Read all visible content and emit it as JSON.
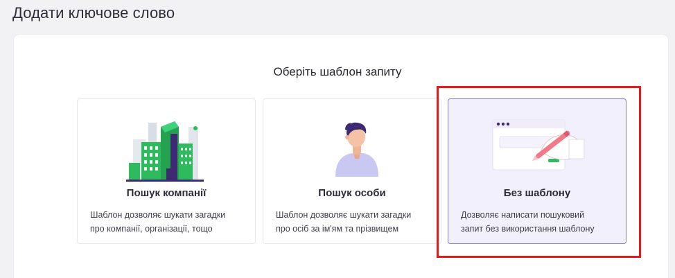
{
  "page": {
    "title": "Додати ключове слово"
  },
  "dialog": {
    "prompt": "Оберіть шаблон запиту"
  },
  "cards": [
    {
      "title": "Пошук компанії",
      "desc_line1": "Шаблон дозволяє шукати загадки",
      "desc_line2": "про компанії, організації, тощо",
      "illustration": "buildings-icon"
    },
    {
      "title": "Пошук особи",
      "desc_line1": "Шаблон дозволяє шукати загадки",
      "desc_line2": "про осіб за ім'ям та прізвищем",
      "illustration": "person-icon"
    },
    {
      "title": "Без шаблону",
      "desc_line1": "Дозволяє написати пошуковий",
      "desc_line2": "запит без використання шаблону",
      "illustration": "writing-hand-icon",
      "selected": true
    }
  ],
  "colors": {
    "accent": "#8a76d8",
    "selected_bg": "#f3f0fd",
    "highlight": "#e31b1b",
    "green": "#2dbb5d"
  }
}
